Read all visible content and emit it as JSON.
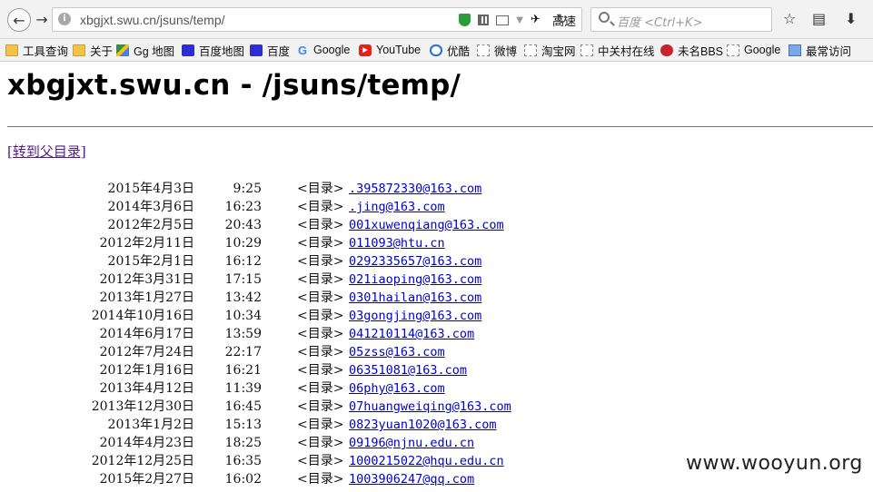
{
  "browser": {
    "url": "xbgjxt.swu.cn/jsuns/temp/",
    "speed_label": "高速",
    "search_placeholder": "百度 <Ctrl+K>"
  },
  "icons": {
    "back": "back-arrow-icon",
    "forward": "forward-arrow-icon",
    "refresh": "refresh-icon",
    "star": "star-icon",
    "library": "library-icon",
    "download": "download-icon"
  },
  "bookmarks": [
    {
      "label": "工具查询",
      "icon": "folder-icon"
    },
    {
      "label": "关于",
      "icon": "folder-icon"
    },
    {
      "label": "Gg 地图",
      "icon": "maps-icon"
    },
    {
      "label": "百度地图",
      "icon": "paw-icon"
    },
    {
      "label": "百度",
      "icon": "paw-icon"
    },
    {
      "label": "Google",
      "icon": "google-icon"
    },
    {
      "label": "YouTube",
      "icon": "youtube-icon"
    },
    {
      "label": "优酷",
      "icon": "youku-icon"
    },
    {
      "label": "微博",
      "icon": "blank-icon"
    },
    {
      "label": "淘宝网",
      "icon": "blank-icon"
    },
    {
      "label": "中关村在线",
      "icon": "blank-icon"
    },
    {
      "label": "未名BBS",
      "icon": "red-icon"
    },
    {
      "label": "Google",
      "icon": "blank-icon"
    },
    {
      "label": "最常访问",
      "icon": "blue-icon"
    }
  ],
  "page": {
    "title": "xbgjxt.swu.cn - /jsuns/temp/",
    "parent_link": "[转到父目录]"
  },
  "entries": [
    {
      "date": "2015年4月3日",
      "time": "9:25",
      "type": "<目录>",
      "name": ".395872330@163.com"
    },
    {
      "date": "2014年3月6日",
      "time": "16:23",
      "type": "<目录>",
      "name": ".jing@163.com"
    },
    {
      "date": "2012年2月5日",
      "time": "20:43",
      "type": "<目录>",
      "name": "001xuwenqiang@163.com"
    },
    {
      "date": "2012年2月11日",
      "time": "10:29",
      "type": "<目录>",
      "name": "011093@htu.cn"
    },
    {
      "date": "2015年2月1日",
      "time": "16:12",
      "type": "<目录>",
      "name": "0292335657@163.com"
    },
    {
      "date": "2012年3月31日",
      "time": "17:15",
      "type": "<目录>",
      "name": "021iaoping@163.com"
    },
    {
      "date": "2013年1月27日",
      "time": "13:42",
      "type": "<目录>",
      "name": "0301hailan@163.com"
    },
    {
      "date": "2014年10月16日",
      "time": "10:34",
      "type": "<目录>",
      "name": "03gongjing@163.com"
    },
    {
      "date": "2014年6月17日",
      "time": "13:59",
      "type": "<目录>",
      "name": "041210114@163.com"
    },
    {
      "date": "2012年7月24日",
      "time": "22:17",
      "type": "<目录>",
      "name": "05zss@163.com"
    },
    {
      "date": "2012年1月16日",
      "time": "16:21",
      "type": "<目录>",
      "name": "06351081@163.com"
    },
    {
      "date": "2013年4月12日",
      "time": "11:39",
      "type": "<目录>",
      "name": "06phy@163.com"
    },
    {
      "date": "2013年12月30日",
      "time": "16:45",
      "type": "<目录>",
      "name": "07huangweiqing@163.com"
    },
    {
      "date": "2013年1月2日",
      "time": "15:13",
      "type": "<目录>",
      "name": "0823yuan1020@163.com"
    },
    {
      "date": "2014年4月23日",
      "time": "18:25",
      "type": "<目录>",
      "name": "09196@njnu.edu.cn"
    },
    {
      "date": "2012年12月25日",
      "time": "16:35",
      "type": "<目录>",
      "name": "1000215022@hqu.edu.cn"
    },
    {
      "date": "2015年2月27日",
      "time": "16:02",
      "type": "<目录>",
      "name": "1003906247@qq.com"
    }
  ],
  "watermark": "www.wooyun.org"
}
